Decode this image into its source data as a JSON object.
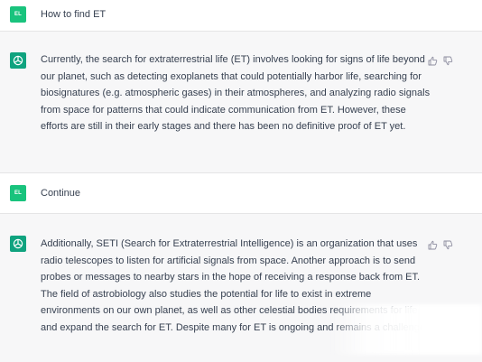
{
  "conversation": {
    "turns": [
      {
        "role": "user",
        "avatar_text": "EL",
        "text": "How to find ET"
      },
      {
        "role": "assistant",
        "text": "Currently, the search for extraterrestrial life (ET) involves looking for signs of life beyond our planet, such as detecting exoplanets that could potentially harbor life, searching for biosignatures (e.g. atmospheric gases) in their atmospheres, and analyzing radio signals from space for patterns that could indicate communication from ET. However, these efforts are still in their early stages and there has been no definitive proof of ET yet."
      },
      {
        "role": "user",
        "avatar_text": "EL",
        "text": "Continue"
      },
      {
        "role": "assistant",
        "text": "Additionally, SETI (Search for Extraterrestrial Intelligence) is an organization that uses radio telescopes to listen for artificial signals from space. Another approach is to send probes or messages to nearby stars in the hope of receiving a response back from ET. The field of astrobiology also studies the potential for life to exist in extreme environments on our own planet, as well as other celestial bodies requirements for life and expand the search for ET. Despite many for ET is ongoing and remains a challenge."
      }
    ]
  },
  "icons": {
    "assistant_avatar": "openai-logo-icon",
    "thumbs_up": "thumbs-up-icon",
    "thumbs_down": "thumbs-down-icon"
  },
  "colors": {
    "user_avatar": "#19c37d",
    "assistant_avatar": "#10a37f",
    "assistant_row_bg": "#f7f7f8",
    "text": "#374151"
  }
}
